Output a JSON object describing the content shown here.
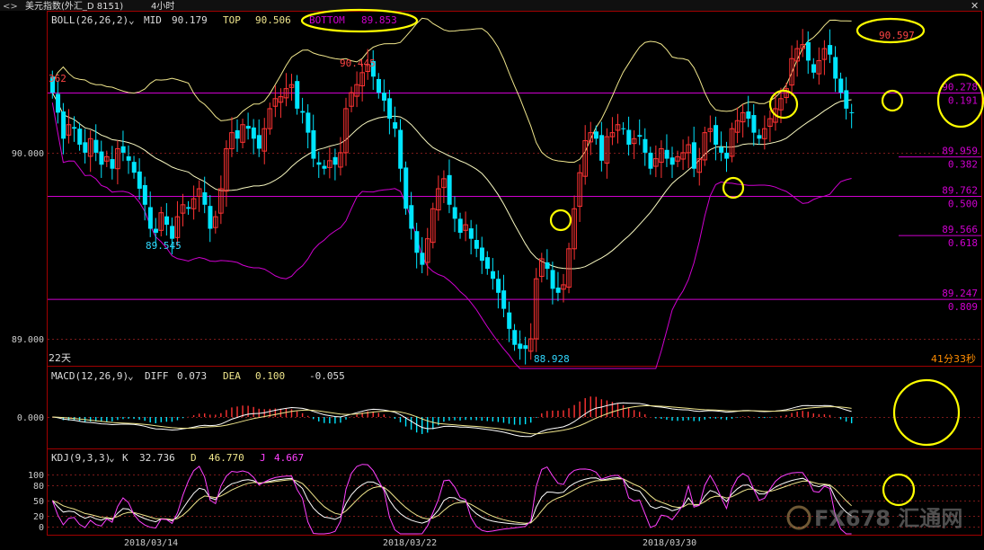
{
  "window": {
    "title": "美元指数(外汇_D 8151)",
    "period": "4小时",
    "close_icon": "close-x-icon"
  },
  "colors": {
    "up": "#ff3333",
    "down": "#00e5ff",
    "mid": "#f0e68c",
    "band": "#d000d0",
    "level": "#d000d0",
    "annot": "#ffff00",
    "grid": "#7a1a1a",
    "frame": "#a00000"
  },
  "boll": {
    "label": "BOLL(26,26,2)",
    "mid_label": "MID",
    "mid_value": "90.179",
    "top_label": "TOP",
    "top_value": "90.506",
    "bottom_label": "BOTTOM",
    "bottom_value": "89.853"
  },
  "price_axis": {
    "labels": [
      "90.000",
      "89.000"
    ],
    "values": [
      90.0,
      89.0
    ],
    "ylim": [
      88.92,
      90.68
    ]
  },
  "macd": {
    "label": "MACD(12,26,9)",
    "diff_label": "DIFF",
    "diff_value": "0.073",
    "dea_label": "DEA",
    "dea_value": "0.100",
    "macd_value": "-0.055",
    "axis_label": "0.000"
  },
  "kdj": {
    "label": "KDJ(9,3,3)",
    "k_label": "K",
    "k_value": "32.736",
    "d_label": "D",
    "d_value": "46.770",
    "j_label": "J",
    "j_value": "4.667",
    "axis_labels": [
      "100",
      "80",
      "50",
      "20",
      "0"
    ],
    "axis_values": [
      100,
      80,
      50,
      20,
      0
    ]
  },
  "x_axis": {
    "dates": [
      "2018/03/14",
      "2018/03/22",
      "2018/03/30"
    ],
    "date_index": [
      22,
      70,
      118
    ]
  },
  "annotations": {
    "left_edge_value": "362",
    "high_1": "90.445",
    "low_1": "89.545",
    "low_2": "88.928",
    "high_2": "90.597",
    "days_label": "22天",
    "countdown": "41分33秒"
  },
  "levels": [
    {
      "price": "90.278",
      "ratio": "0.191",
      "value": 90.278
    },
    {
      "price": "89.959",
      "ratio": "0.382",
      "value": 89.959
    },
    {
      "price": "89.762",
      "ratio": "0.500",
      "value": 89.762
    },
    {
      "price": "89.566",
      "ratio": "0.618",
      "value": 89.566
    },
    {
      "price": "89.247",
      "ratio": "0.809",
      "value": 89.247
    }
  ],
  "chart_data": {
    "type": "candlestick",
    "title": "美元指数(外汇_D 8151) 4小时",
    "indicators": [
      "BOLL(26,26,2)",
      "MACD(12,26,9)",
      "KDJ(9,3,3)"
    ],
    "close": [
      90.28,
      90.18,
      90.05,
      90.12,
      90.1,
      90.02,
      89.98,
      90.05,
      89.98,
      89.92,
      89.96,
      89.9,
      90.0,
      89.98,
      89.94,
      89.88,
      89.8,
      89.72,
      89.6,
      89.58,
      89.68,
      89.62,
      89.55,
      89.66,
      89.72,
      89.7,
      89.75,
      89.8,
      89.72,
      89.6,
      89.66,
      89.8,
      90.0,
      90.08,
      90.05,
      90.12,
      90.1,
      90.05,
      90.0,
      90.1,
      90.2,
      90.25,
      90.26,
      90.3,
      90.32,
      90.2,
      90.18,
      90.08,
      89.95,
      89.92,
      89.9,
      89.94,
      89.92,
      89.98,
      90.2,
      90.28,
      90.32,
      90.38,
      90.42,
      90.36,
      90.28,
      90.24,
      90.15,
      90.1,
      89.9,
      89.7,
      89.6,
      89.48,
      89.42,
      89.55,
      89.7,
      89.8,
      89.85,
      89.72,
      89.65,
      89.58,
      89.62,
      89.55,
      89.5,
      89.44,
      89.4,
      89.35,
      89.28,
      89.2,
      89.1,
      89.02,
      89.0,
      89.0,
      89.05,
      89.35,
      89.45,
      89.4,
      89.3,
      89.28,
      89.32,
      89.5,
      89.7,
      89.88,
      90.04,
      90.08,
      90.05,
      89.94,
      90.06,
      90.08,
      90.12,
      90.1,
      90.02,
      90.05,
      90.06,
      89.98,
      89.9,
      89.95,
      90.0,
      89.95,
      89.92,
      89.96,
      89.98,
      90.02,
      89.9,
      89.95,
      90.08,
      90.1,
      90.02,
      89.98,
      89.95,
      90.1,
      90.14,
      90.18,
      90.15,
      90.08,
      90.05,
      90.1,
      90.15,
      90.2,
      90.25,
      90.3,
      90.45,
      90.5,
      90.52,
      90.44,
      90.38,
      90.44,
      90.5,
      90.47,
      90.35,
      90.28,
      90.2,
      90.18
    ]
  }
}
